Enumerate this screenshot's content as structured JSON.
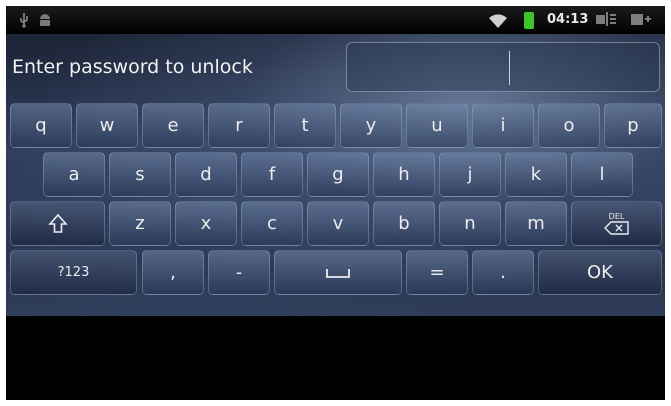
{
  "status_bar": {
    "time": "04:13",
    "icons": [
      "usb-icon",
      "android-icon",
      "wifi-icon",
      "battery-icon",
      "signal-icon",
      "notification-icon"
    ],
    "battery_color": "#3cc42d"
  },
  "unlock": {
    "prompt": "Enter password to unlock",
    "password_value": ""
  },
  "keyboard": {
    "row1": [
      "q",
      "w",
      "e",
      "r",
      "t",
      "y",
      "u",
      "i",
      "o",
      "p"
    ],
    "row2": [
      "a",
      "s",
      "d",
      "f",
      "g",
      "h",
      "j",
      "k",
      "l"
    ],
    "row3": [
      "z",
      "x",
      "c",
      "v",
      "b",
      "n",
      "m"
    ],
    "shift_icon": "shift-icon",
    "delete_label": "DEL",
    "symbols_label": "?123",
    "comma_label": ",",
    "dash_label": "-",
    "space_icon": "space-icon",
    "equals_label": "=",
    "period_label": ".",
    "ok_label": "OK"
  }
}
